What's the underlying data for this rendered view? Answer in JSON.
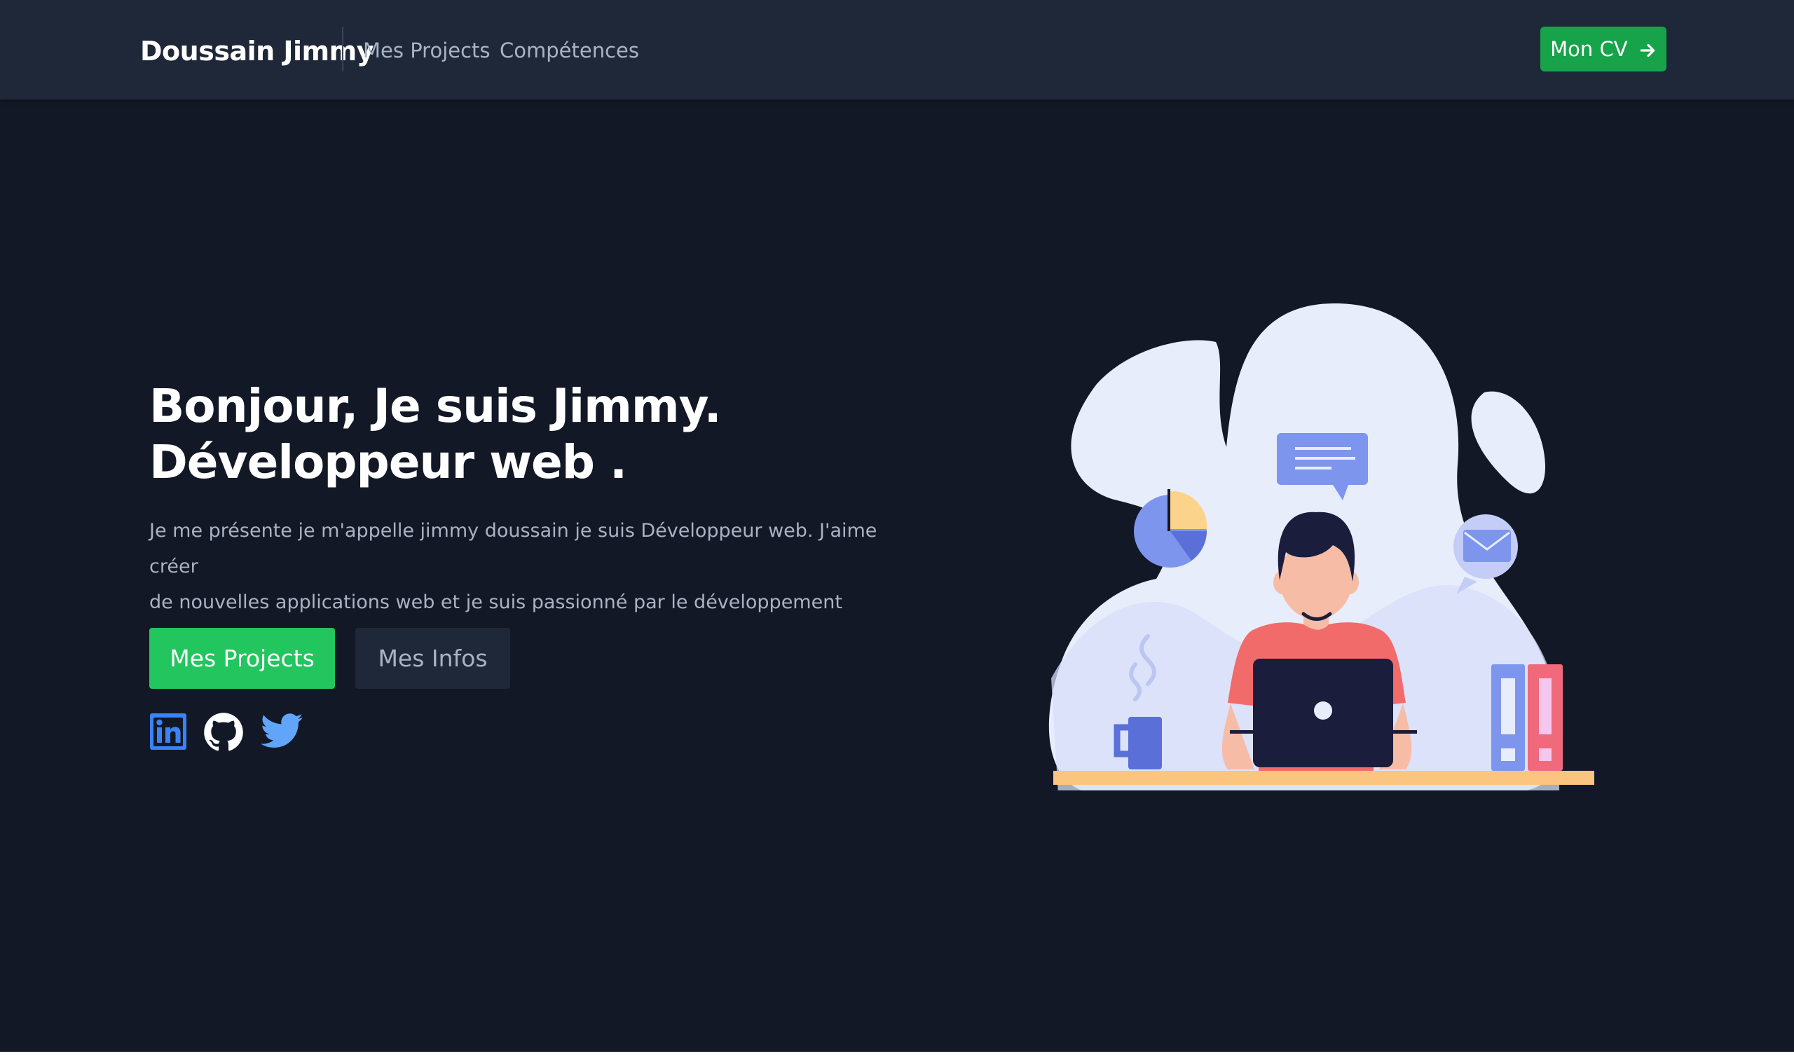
{
  "nav": {
    "brand": "Doussain Jimmy",
    "links": [
      "Mes Projects",
      "Compétences"
    ],
    "cv_button": "Mon CV"
  },
  "hero": {
    "title_line1": "Bonjour, Je suis Jimmy.",
    "title_line2": "Développeur web .",
    "intro_line1": "Je me présente je m'appelle jimmy doussain je suis Développeur web. J'aime créer",
    "intro_line2": "de nouvelles applications web et je suis passionné par le développement web.",
    "primary_button": "Mes Projects",
    "secondary_button": "Mes Infos"
  },
  "social": [
    "linkedin-icon",
    "github-icon",
    "twitter-icon"
  ],
  "colors": {
    "background": "#121826",
    "navbar": "#1f2838",
    "cv_button": "#16a34a",
    "primary_button": "#22c55e",
    "linkedin": "#3b82f6",
    "twitter": "#60a5fa"
  }
}
